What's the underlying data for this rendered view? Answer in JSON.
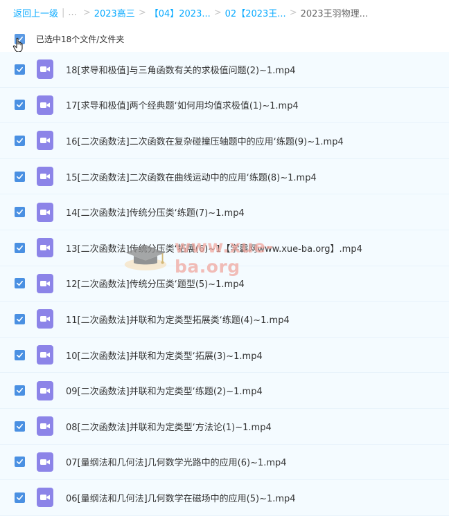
{
  "breadcrumb": {
    "back": "返回上一级",
    "dots": "...",
    "items": [
      "2023高三",
      "【04】2023...",
      "02【2023王..."
    ],
    "current": "2023王羽物理..."
  },
  "selection": {
    "label": "已选中18个文件/文件夹"
  },
  "files": [
    {
      "name": "18[求导和极值]与三角函数有关的求极值问题(2)~1.mp4",
      "checked": true
    },
    {
      "name": "17[求导和极值]两个经典题‘如何用均值求极值(1)~1.mp4",
      "checked": true
    },
    {
      "name": "16[二次函数法]二次函数在复杂碰撞压轴题中的应用‘练题(9)~1.mp4",
      "checked": true
    },
    {
      "name": "15[二次函数法]二次函数在曲线运动中的应用‘练题(8)~1.mp4",
      "checked": true
    },
    {
      "name": "14[二次函数法]传统分压类‘练题(7)~1.mp4",
      "checked": true
    },
    {
      "name": "13[二次函数法]传统分压类‘拓展(6)~1【学霸网www.xue-ba.org】.mp4",
      "checked": true
    },
    {
      "name": "12[二次函数法]传统分压类‘题型(5)~1.mp4",
      "checked": true
    },
    {
      "name": "11[二次函数法]并联和为定类型拓展类‘练题(4)~1.mp4",
      "checked": true
    },
    {
      "name": "10[二次函数法]并联和为定类型‘拓展(3)~1.mp4",
      "checked": true
    },
    {
      "name": "09[二次函数法]并联和为定类型‘练题(2)~1.mp4",
      "checked": true
    },
    {
      "name": "08[二次函数法]并联和为定类型‘方法论(1)~1.mp4",
      "checked": true
    },
    {
      "name": "07[量纲法和几何法]几何数学光路中的应用(6)~1.mp4",
      "checked": true
    },
    {
      "name": "06[量纲法和几何法]几何数学在磁场中的应用(5)~1.mp4",
      "checked": true
    }
  ],
  "watermark": {
    "text": "www.xue-ba.org"
  },
  "colors": {
    "link": "#09aaff",
    "checkbox": "#4a90e2",
    "video_icon": "#8c84e8",
    "row_bg": "#f4fbff"
  }
}
